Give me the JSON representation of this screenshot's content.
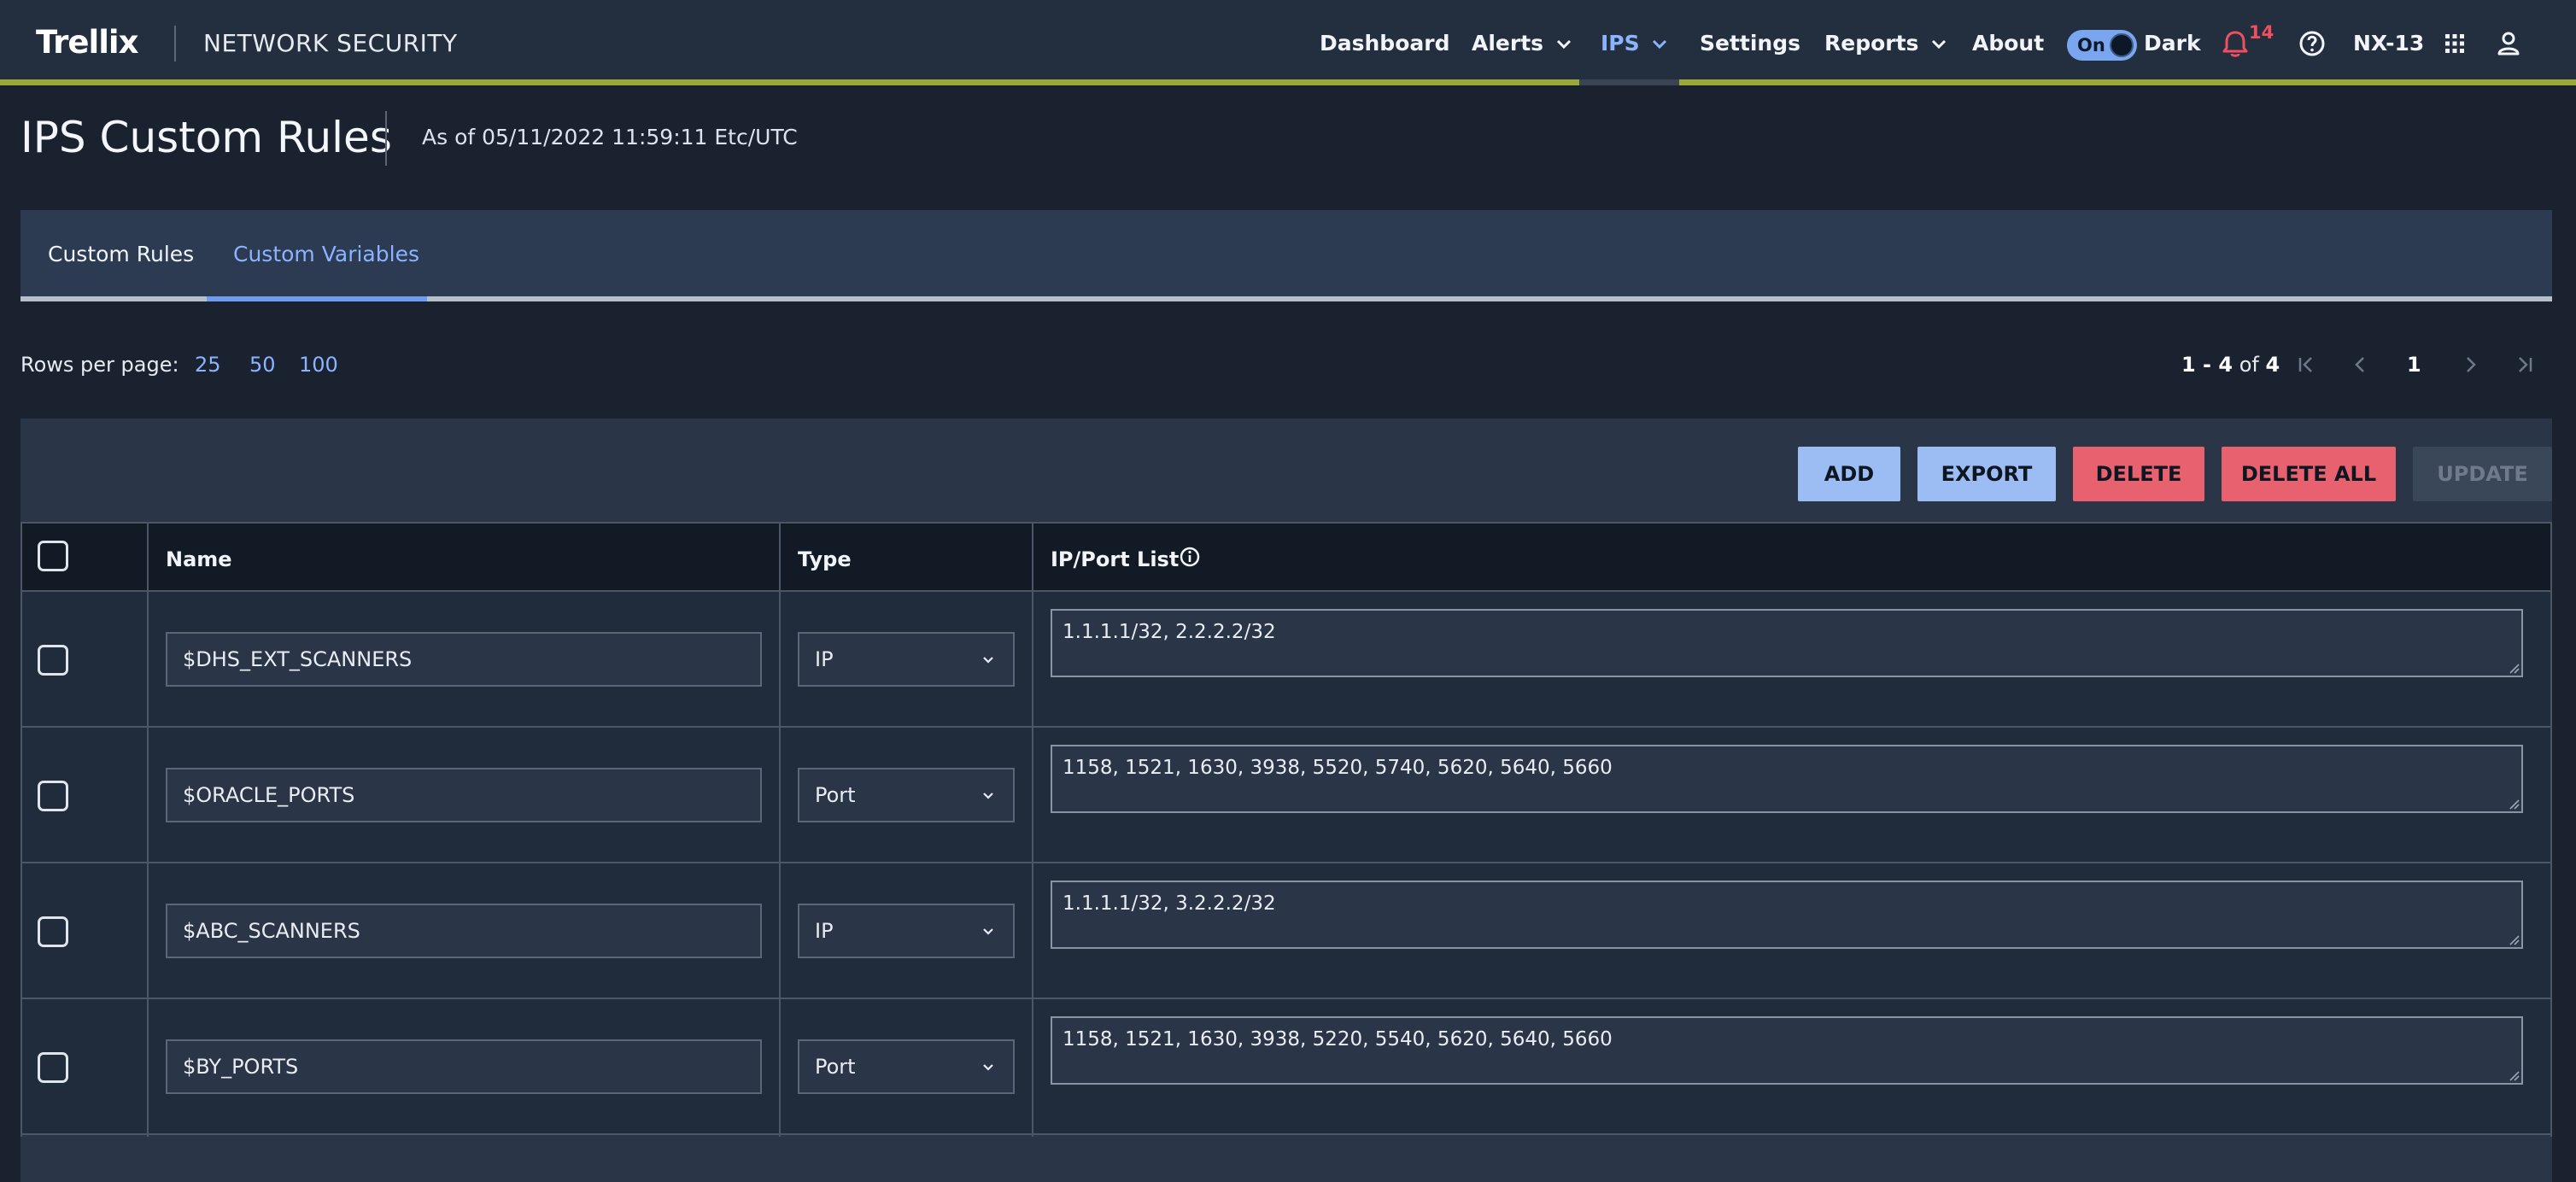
{
  "brand": {
    "logo_text": "Trellix",
    "product": "NETWORK SECURITY"
  },
  "nav": {
    "items": [
      {
        "label": "Dashboard"
      },
      {
        "label": "Alerts"
      },
      {
        "label": "IPS"
      },
      {
        "label": "Settings"
      },
      {
        "label": "Reports"
      },
      {
        "label": "About"
      }
    ],
    "toggle_label": "On",
    "theme_label": "Dark",
    "notification_count": "14",
    "appliance": "NX-13"
  },
  "header": {
    "title": "IPS Custom Rules",
    "as_of": "As of 05/11/2022 11:59:11 Etc/UTC"
  },
  "tabs": [
    {
      "label": "Custom Rules"
    },
    {
      "label": "Custom Variables"
    }
  ],
  "paging": {
    "rows_label": "Rows per page:",
    "options": [
      "25",
      "50",
      "100"
    ],
    "range": "1 - 4",
    "of_label": "of",
    "total": "4",
    "current_page": "1"
  },
  "actions": {
    "add": "ADD",
    "export": "EXPORT",
    "delete": "DELETE",
    "delete_all": "DELETE ALL",
    "update": "UPDATE"
  },
  "table": {
    "headers": {
      "name": "Name",
      "type": "Type",
      "list": "IP/Port List"
    },
    "rows": [
      {
        "name": "$DHS_EXT_SCANNERS",
        "type": "IP",
        "list": "1.1.1.1/32, 2.2.2.2/32"
      },
      {
        "name": "$ORACLE_PORTS",
        "type": "Port",
        "list": "1158, 1521, 1630, 3938, 5520, 5740, 5620, 5640, 5660"
      },
      {
        "name": "$ABC_SCANNERS",
        "type": "IP",
        "list": "1.1.1.1/32, 3.2.2.2/32"
      },
      {
        "name": "$BY_PORTS",
        "type": "Port",
        "list": "1158, 1521, 1630, 3938, 5220, 5540, 5620, 5640, 5660"
      }
    ]
  },
  "colors": {
    "accent_blue": "#8ab4ff",
    "primary_button": "#9cbdf4",
    "danger_button": "#e8616f",
    "nav_stripe": "#9aa83c",
    "notification": "#ef4f5e"
  },
  "icons": [
    "chevron-down-icon",
    "bell-icon",
    "help-icon",
    "apps-grid-icon",
    "user-icon",
    "info-icon",
    "first-page-icon",
    "prev-page-icon",
    "next-page-icon",
    "last-page-icon"
  ]
}
